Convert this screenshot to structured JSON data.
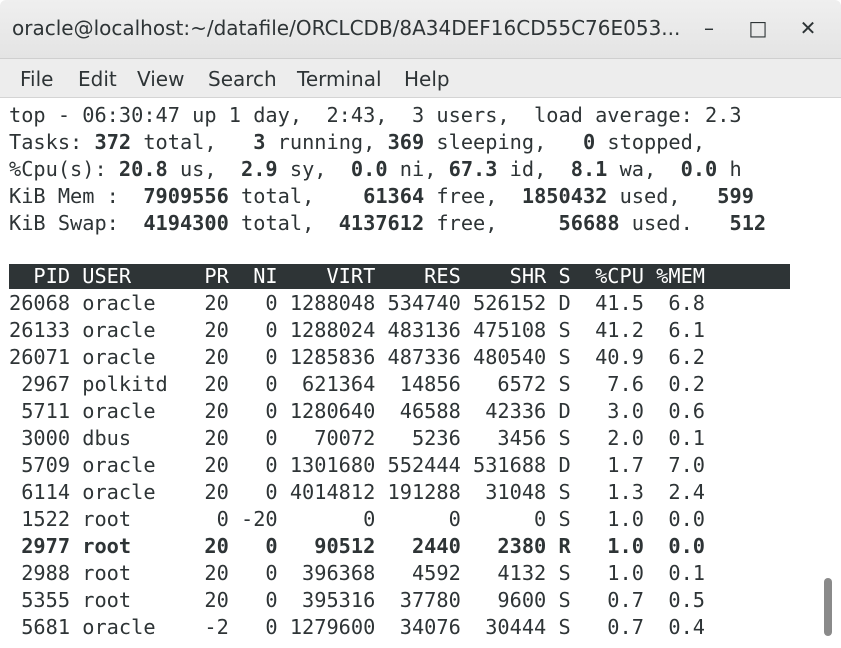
{
  "window": {
    "title": "oracle@localhost:~/datafile/ORCLCDB/8A34DEF16CD55C76E053...",
    "minimize_glyph": "–",
    "maximize_glyph": "□",
    "close_glyph": "✕"
  },
  "menu": [
    "File",
    "Edit",
    "View",
    "Search",
    "Terminal",
    "Help"
  ],
  "summary": {
    "line1": "top - 06:30:47 up 1 day,  2:43,  3 users,  load average: 2.3",
    "tasks": {
      "label": "Tasks: ",
      "total": "372",
      "t1": " total,   ",
      "running": "3",
      "t2": " running, ",
      "sleeping": "369",
      "t3": " sleeping,   ",
      "stopped": "0",
      "t4": " stopped,"
    },
    "cpu": {
      "label": "%Cpu(s): ",
      "us": "20.8",
      "t1": " us,  ",
      "sy": "2.9",
      "t2": " sy,  ",
      "ni": "0.0",
      "t3": " ni, ",
      "id": "67.3",
      "t4": " id,  ",
      "wa": "8.1",
      "t5": " wa,  ",
      "hi": "0.0",
      "t6": " h"
    },
    "mem": {
      "label": "KiB Mem :  ",
      "total": "7909556",
      "t1": " total,    ",
      "free": "61364",
      "t2": " free,  ",
      "used": "1850432",
      "t3": " used,   ",
      "cache": "599"
    },
    "swap": {
      "label": "KiB Swap:  ",
      "total": "4194300",
      "t1": " total,  ",
      "free": "4137612",
      "t2": " free,     ",
      "used": "56688",
      "t3": " used.   ",
      "avail": "512"
    }
  },
  "table": {
    "header": "  PID USER      PR  NI    VIRT    RES    SHR S  %CPU %MEM",
    "rows": [
      "26068 oracle    20   0 1288048 534740 526152 D  41.5  6.8",
      "26133 oracle    20   0 1288024 483136 475108 S  41.2  6.1",
      "26071 oracle    20   0 1285836 487336 480540 S  40.9  6.2",
      " 2967 polkitd   20   0  621364  14856   6572 S   7.6  0.2",
      " 5711 oracle    20   0 1280640  46588  42336 D   3.0  0.6",
      " 3000 dbus      20   0   70072   5236   3456 S   2.0  0.1",
      " 5709 oracle    20   0 1301680 552444 531688 D   1.7  7.0",
      " 6114 oracle    20   0 4014812 191288  31048 S   1.3  2.4",
      " 1522 root       0 -20       0      0      0 S   1.0  0.0",
      " 2977 root      20   0   90512   2440   2380 R   1.0  0.0",
      " 2988 root      20   0  396368   4592   4132 S   1.0  0.1",
      " 5355 root      20   0  395316  37780   9600 S   0.7  0.5",
      " 5681 oracle    -2   0 1279600  34076  30444 S   0.7  0.4"
    ]
  }
}
